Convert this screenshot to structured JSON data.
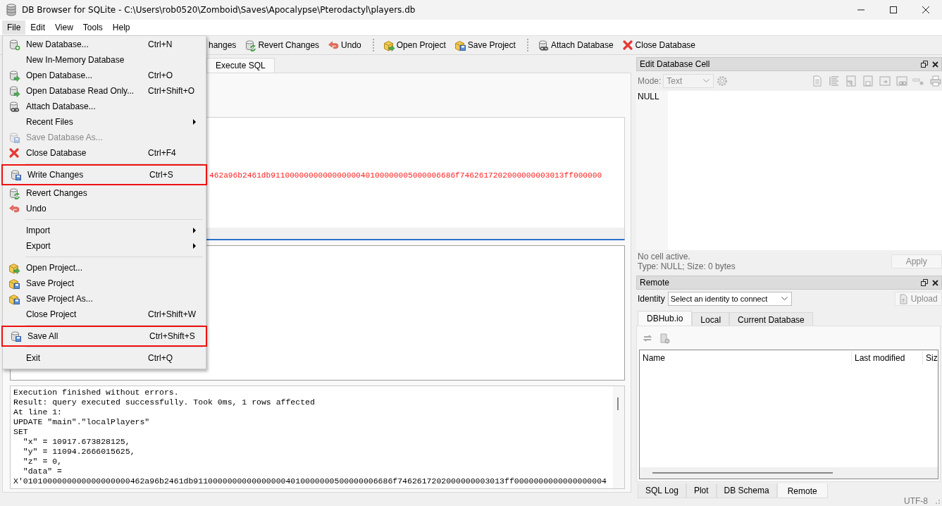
{
  "window": {
    "title": "DB Browser for SQLite - C:\\Users\\rob0520\\Zomboid\\Saves\\Apocalypse\\Pterodactyl\\players.db"
  },
  "menubar": [
    {
      "label": "File",
      "selected": true
    },
    {
      "label": "Edit",
      "selected": false
    },
    {
      "label": "View",
      "selected": false
    },
    {
      "label": "Tools",
      "selected": false
    },
    {
      "label": "Help",
      "selected": false
    }
  ],
  "toolbar": [
    {
      "kind": "button",
      "label": "hanges"
    },
    {
      "kind": "button",
      "label": "Revert Changes"
    },
    {
      "kind": "button",
      "label": "Undo"
    },
    {
      "kind": "separator"
    },
    {
      "kind": "button",
      "label": "Open Project"
    },
    {
      "kind": "button",
      "label": "Save Project"
    },
    {
      "kind": "separator"
    },
    {
      "kind": "button",
      "label": "Attach Database"
    },
    {
      "kind": "button",
      "label": "Close Database"
    }
  ],
  "main_tabs": [
    {
      "label": "Execute SQL",
      "selected": true
    }
  ],
  "editor": {
    "line": "462a96b2461db911000000000000000040100000005000006686f7462617202000000003013ff000000"
  },
  "message_log": [
    "Execution finished without errors.",
    "Result: query executed successfully. Took 0ms, 1 rows affected",
    "At line 1:",
    "UPDATE \"main\".\"localPlayers\"",
    "SET",
    "  \"x\" = 10917.673828125,",
    "  \"y\" = 11094.2666015625,",
    "  \"z\" = 0,",
    "  \"data\" =",
    "X'0101000000000000000000462a96b2461db91100000000000000004010000000500000006686f7462617202000000003013ff0000000000000000004"
  ],
  "file_menu": {
    "items": [
      {
        "kind": "item",
        "label": "New Database...",
        "shortcut": "Ctrl+N",
        "disabled": false,
        "highlighted": false,
        "submenu": false
      },
      {
        "kind": "item",
        "label": "New In-Memory Database",
        "disabled": false,
        "highlighted": false,
        "submenu": false
      },
      {
        "kind": "item",
        "label": "Open Database...",
        "shortcut": "Ctrl+O",
        "disabled": false,
        "highlighted": false,
        "submenu": false
      },
      {
        "kind": "item",
        "label": "Open Database Read Only...",
        "shortcut": "Ctrl+Shift+O",
        "disabled": false,
        "highlighted": false,
        "submenu": false
      },
      {
        "kind": "item",
        "label": "Attach Database...",
        "disabled": false,
        "highlighted": false,
        "submenu": false
      },
      {
        "kind": "item",
        "label": "Recent Files",
        "disabled": false,
        "highlighted": false,
        "submenu": true
      },
      {
        "kind": "item",
        "label": "Save Database As...",
        "disabled": true,
        "highlighted": false,
        "submenu": false
      },
      {
        "kind": "item",
        "label": "Close Database",
        "shortcut": "Ctrl+F4",
        "disabled": false,
        "highlighted": false,
        "submenu": false
      },
      {
        "kind": "separator"
      },
      {
        "kind": "item",
        "label": "Write Changes",
        "shortcut": "Ctrl+S",
        "disabled": false,
        "highlighted": true,
        "submenu": false
      },
      {
        "kind": "item",
        "label": "Revert Changes",
        "disabled": false,
        "highlighted": false,
        "submenu": false
      },
      {
        "kind": "item",
        "label": "Undo",
        "disabled": false,
        "highlighted": false,
        "submenu": false
      },
      {
        "kind": "separator"
      },
      {
        "kind": "item",
        "label": "Import",
        "disabled": false,
        "highlighted": false,
        "submenu": true
      },
      {
        "kind": "item",
        "label": "Export",
        "disabled": false,
        "highlighted": false,
        "submenu": true
      },
      {
        "kind": "separator"
      },
      {
        "kind": "item",
        "label": "Open Project...",
        "disabled": false,
        "highlighted": false,
        "submenu": false
      },
      {
        "kind": "item",
        "label": "Save Project",
        "disabled": false,
        "highlighted": false,
        "submenu": false
      },
      {
        "kind": "item",
        "label": "Save Project As...",
        "disabled": false,
        "highlighted": false,
        "submenu": false
      },
      {
        "kind": "item",
        "label": "Close Project",
        "shortcut": "Ctrl+Shift+W",
        "disabled": false,
        "highlighted": false,
        "submenu": false
      },
      {
        "kind": "separator"
      },
      {
        "kind": "item",
        "label": "Save All",
        "shortcut": "Ctrl+Shift+S",
        "disabled": false,
        "highlighted": true,
        "submenu": false
      },
      {
        "kind": "separator"
      },
      {
        "kind": "item",
        "label": "Exit",
        "shortcut": "Ctrl+Q",
        "disabled": false,
        "highlighted": false,
        "submenu": false
      }
    ]
  },
  "edit_cell": {
    "title": "Edit Database Cell",
    "mode_label": "Mode:",
    "mode": "Text",
    "null_label": "NULL",
    "status": "No cell active.",
    "type_info": "Type: NULL; Size: 0 bytes",
    "apply": "Apply"
  },
  "remote": {
    "title": "Remote",
    "identity_label": "Identity",
    "identity": "Select an identity to connect",
    "upload": "Upload",
    "tabs": [
      {
        "label": "DBHub.io",
        "selected": true
      },
      {
        "label": "Local",
        "selected": false
      },
      {
        "label": "Current Database",
        "selected": false
      }
    ],
    "columns": [
      "Name",
      "Last modified",
      "Siz"
    ]
  },
  "dock_tabs": [
    {
      "label": "SQL Log",
      "selected": false
    },
    {
      "label": "Plot",
      "selected": false
    },
    {
      "label": "DB Schema",
      "selected": false
    },
    {
      "label": "Remote",
      "selected": true
    }
  ],
  "status_bar": {
    "encoding": "UTF-8"
  }
}
